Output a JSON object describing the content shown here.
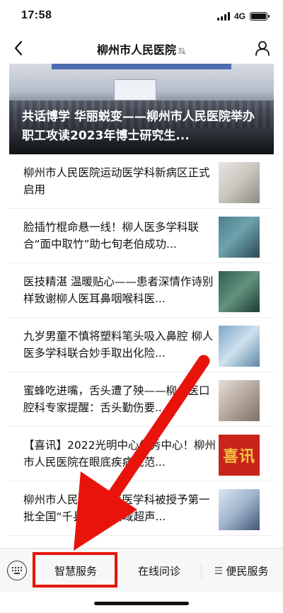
{
  "status_bar": {
    "time": "17:58",
    "network": "4G"
  },
  "nav": {
    "title": "柳州市人民医院"
  },
  "hero": {
    "title": "共话博学 华丽蜕变——柳州市人民医院举办职工攻读2023年博士研究生..."
  },
  "news": [
    {
      "title": "柳州市人民医院运动医学科新病区正式启用"
    },
    {
      "title": "脸插竹棍命悬一线！柳人医多学科联合“面中取竹”助七旬老伯成功..."
    },
    {
      "title": "医技精湛 温暖贴心——患者深情作诗别样致谢柳人医耳鼻咽喉科医..."
    },
    {
      "title": "九岁男童不慎将塑料笔头吸入鼻腔 柳人医多学科联合妙手取出化险..."
    },
    {
      "title": "蜜蜂吃进嘴，舌头遭了殃——柳人医口腔科专家提醒：舌头勤伤要..."
    },
    {
      "title": "【喜讯】2022光明中心优秀中心！柳州市人民医院在眼底疾病规范...",
      "thumb_text": "喜讯"
    },
    {
      "title": "柳州市人民医院超声医学科被授予第一批全国“千县工程”县域超声..."
    }
  ],
  "bottom_menu": {
    "items": [
      "智慧服务",
      "在线问诊",
      "便民服务"
    ]
  },
  "annotation": {
    "color": "#e8140c"
  }
}
